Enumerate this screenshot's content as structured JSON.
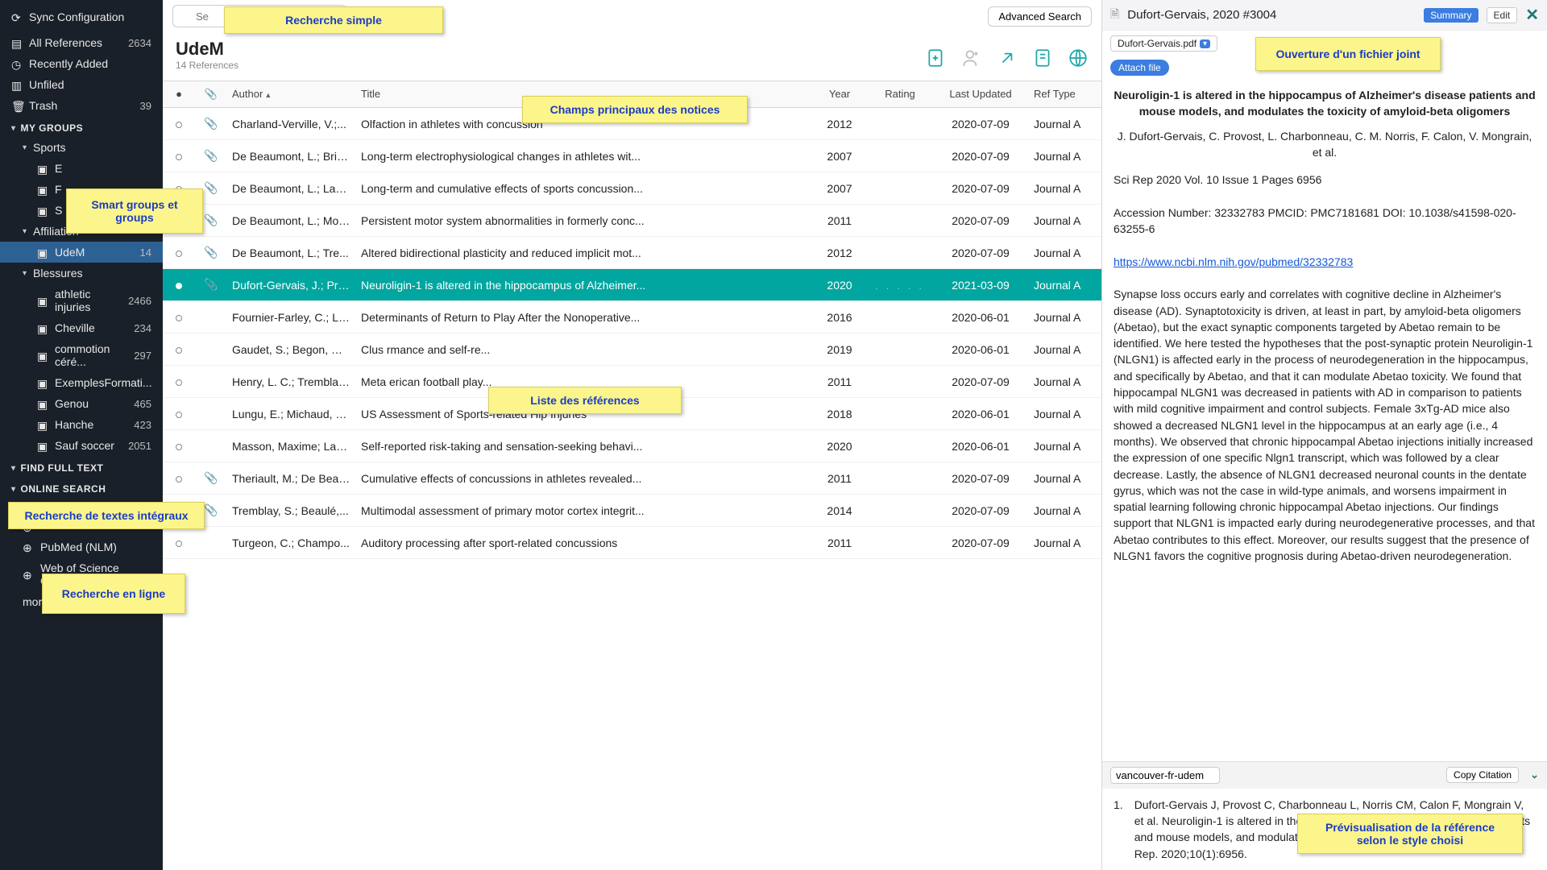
{
  "sidebar": {
    "sync": "Sync Configuration",
    "allrefs": {
      "label": "All References",
      "count": "2634"
    },
    "recent": "Recently Added",
    "unfiled": "Unfiled",
    "trash": {
      "label": "Trash",
      "count": "39"
    },
    "mygroups": "MY GROUPS",
    "sports": "Sports",
    "sportsItems": [
      {
        "label": "E"
      },
      {
        "label": "F"
      },
      {
        "label": "S"
      }
    ],
    "affiliation": "Affiliation",
    "udem": {
      "label": "UdeM",
      "count": "14"
    },
    "blessures": "Blessures",
    "blist": [
      {
        "label": "athletic injuries",
        "count": "2466"
      },
      {
        "label": "Cheville",
        "count": "234"
      },
      {
        "label": "commotion céré...",
        "count": "297"
      },
      {
        "label": "ExemplesFormati...",
        "count": ""
      },
      {
        "label": "Genou",
        "count": "465"
      },
      {
        "label": "Hanche",
        "count": "423"
      },
      {
        "label": "Sauf soccer",
        "count": "2051"
      }
    ],
    "findfull": "FIND FULL TEXT",
    "onlinesearch": "ONLINE SEARCH",
    "osearch": [
      {
        "label": ""
      },
      {
        "label": ""
      },
      {
        "label": "PubMed (NLM)"
      },
      {
        "label": "Web of Science Core..."
      }
    ],
    "more": "more..."
  },
  "toolbar": {
    "placeholder": "Se",
    "advanced": "Advanced Search"
  },
  "group": {
    "title": "UdeM",
    "sub": "14 References"
  },
  "columns": {
    "author": "Author",
    "title": "Title",
    "year": "Year",
    "rating": "Rating",
    "updated": "Last Updated",
    "type": "Ref Type"
  },
  "rows": [
    {
      "clip": true,
      "author": "Charland-Verville, V.;...",
      "title": "Olfaction in athletes with concussion",
      "year": "2012",
      "upd": "2020-07-09",
      "type": "Journal A"
    },
    {
      "clip": true,
      "author": "De Beaumont, L.; Bris...",
      "title": "Long-term electrophysiological changes in athletes wit...",
      "year": "2007",
      "upd": "2020-07-09",
      "type": "Journal A"
    },
    {
      "clip": true,
      "author": "De Beaumont, L.; Lass...",
      "title": "Long-term and cumulative effects of sports concussion...",
      "year": "2007",
      "upd": "2020-07-09",
      "type": "Journal A"
    },
    {
      "clip": true,
      "author": "De Beaumont, L.; Mon...",
      "title": "Persistent motor system abnormalities in formerly conc...",
      "year": "2011",
      "upd": "2020-07-09",
      "type": "Journal A"
    },
    {
      "clip": true,
      "author": "De Beaumont, L.; Tre...",
      "title": "Altered bidirectional plasticity and reduced implicit mot...",
      "year": "2012",
      "upd": "2020-07-09",
      "type": "Journal A"
    },
    {
      "sel": true,
      "dot": true,
      "clip": true,
      "author": "Dufort-Gervais, J.; Pro...",
      "title": "Neuroligin-1 is altered in the hippocampus of Alzheimer...",
      "year": "2020",
      "rating": ". . . . .",
      "upd": "2021-03-09",
      "type": "Journal A"
    },
    {
      "clip": false,
      "author": "Fournier-Farley, C.; La...",
      "title": "Determinants of Return to Play After the Nonoperative...",
      "year": "2016",
      "upd": "2020-06-01",
      "type": "Journal A"
    },
    {
      "clip": false,
      "author": "Gaudet, S.; Begon, M.;...",
      "title": "Clus                                                      rmance and self-re...",
      "year": "2019",
      "upd": "2020-06-01",
      "type": "Journal A"
    },
    {
      "clip": false,
      "author": "Henry, L. C.; Tremblay,...",
      "title": "Meta                                                      erican football play...",
      "year": "2011",
      "upd": "2020-07-09",
      "type": "Journal A"
    },
    {
      "clip": false,
      "author": "Lungu, E.; Michaud, J....",
      "title": "US Assessment of Sports-related Hip Injuries",
      "year": "2018",
      "upd": "2020-06-01",
      "type": "Journal A"
    },
    {
      "clip": false,
      "author": "Masson, Maxime; Lam...",
      "title": "Self-reported risk-taking and sensation-seeking behavi...",
      "year": "2020",
      "upd": "2020-06-01",
      "type": "Journal A"
    },
    {
      "clip": true,
      "author": "Theriault, M.; De Beau...",
      "title": "Cumulative effects of concussions in athletes revealed...",
      "year": "2011",
      "upd": "2020-07-09",
      "type": "Journal A"
    },
    {
      "clip": true,
      "author": "Tremblay, S.; Beaulé,...",
      "title": "Multimodal assessment of primary motor cortex integrit...",
      "year": "2014",
      "upd": "2020-07-09",
      "type": "Journal A"
    },
    {
      "clip": false,
      "author": "Turgeon, C.; Champo...",
      "title": "Auditory processing after sport-related concussions",
      "year": "2011",
      "upd": "2020-07-09",
      "type": "Journal A"
    }
  ],
  "detail": {
    "header": "Dufort-Gervais, 2020 #3004",
    "summary": "Summary",
    "edit": "Edit",
    "file": "Dufort-Gervais.pdf",
    "attach": "Attach file",
    "title": "Neuroligin-1 is altered in the hippocampus of Alzheimer's disease patients and mouse models, and modulates the toxicity of amyloid-beta oligomers",
    "authors": "J. Dufort-Gervais, C. Provost, L. Charbonneau, C. M. Norris, F. Calon, V. Mongrain, et al.",
    "source": "Sci Rep 2020 Vol. 10 Issue 1 Pages 6956",
    "ids": "Accession Number: 32332783 PMCID: PMC7181681 DOI: 10.1038/s41598-020-63255-6",
    "url": "https://www.ncbi.nlm.nih.gov/pubmed/32332783",
    "abstract": "Synapse loss occurs early and correlates with cognitive decline in Alzheimer's disease (AD). Synaptotoxicity is driven, at least in part, by amyloid-beta oligomers (Abetao), but the exact synaptic components targeted by Abetao remain to be identified. We here tested the hypotheses that the post-synaptic protein Neuroligin-1 (NLGN1) is affected early in the process of neurodegeneration in the hippocampus, and specifically by Abetao, and that it can modulate Abetao toxicity. We found that hippocampal NLGN1 was decreased in patients with AD in comparison to patients with mild cognitive impairment and control subjects. Female 3xTg-AD mice also showed a decreased NLGN1 level in the hippocampus at an early age (i.e., 4 months). We observed that chronic hippocampal Abetao injections initially increased the expression of one specific Nlgn1 transcript, which was followed by a clear decrease. Lastly, the absence of NLGN1 decreased neuronal counts in the dentate gyrus, which was not the case in wild-type animals, and worsens impairment in spatial learning following chronic hippocampal Abetao injections. Our findings support that NLGN1 is impacted early during neurodegenerative processes, and that Abetao contributes to this effect. Moreover, our results suggest that the presence of NLGN1 favors the cognitive prognosis during Abetao-driven neurodegeneration.",
    "style": "vancouver-fr-udem",
    "copy": "Copy Citation",
    "citnum": "1.",
    "citation": "Dufort-Gervais J, Provost C, Charbonneau L, Norris CM, Calon F, Mongrain V, et al. Neuroligin-1 is altered in the hippocampus of Alzheimer's disease patients and mouse models, and modulates the toxicity of amyloid-beta oligomers. Sci Rep. 2020;10(1):6956."
  },
  "callouts": {
    "search": "Recherche simple",
    "fields": "Champs principaux des notices",
    "smart": "Smart groups et groups",
    "list": "Liste des références",
    "fulltext": "Recherche de textes intégraux",
    "online": "Recherche en ligne",
    "attach": "Ouverture d'un fichier joint",
    "preview": "Prévisualisation de la référence selon le style choisi"
  }
}
